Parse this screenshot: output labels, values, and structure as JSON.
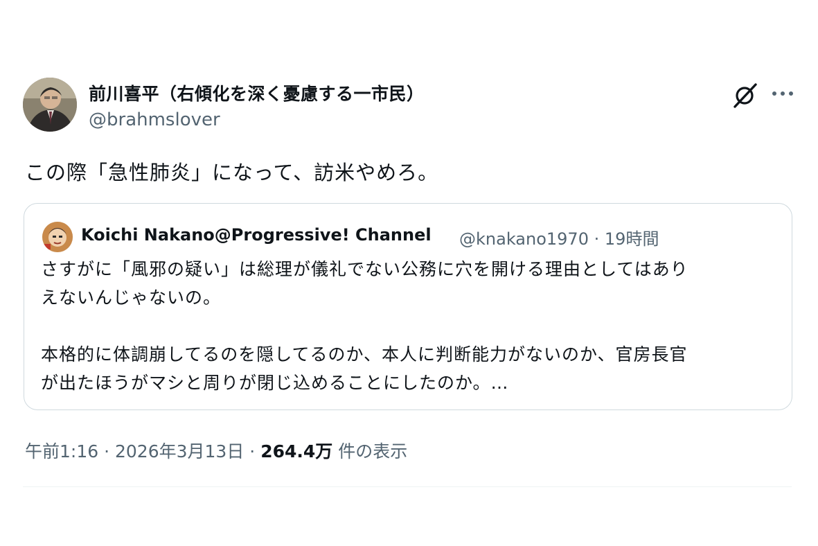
{
  "tweet": {
    "author_name": "前川喜平（右傾化を深く憂慮する一市民）",
    "author_handle": "@brahmslover",
    "text": "この際「急性肺炎」になって、訪米やめろ。",
    "timestamp": "午前1:16",
    "date": "2026年3月13日",
    "views_count": "264.4万",
    "views_label": "件の表示",
    "separator": "·"
  },
  "quoted": {
    "author_name": "Koichi Nakano@Progressive! Channel",
    "author_handle": "@knakano1970",
    "separator": "·",
    "time_ago": "19時間",
    "lines": [
      "さすがに「風邪の疑い」は総理が儀礼でない公務に穴を開ける理由としてはあり",
      "えないんじゃないの。",
      "",
      "本格的に体調崩してるのを隠してるのか、本人に判断能力がないのか、官房長官",
      "が出たほうがマシと周りが閉じ込めることにしたのか。…"
    ]
  },
  "icons": {
    "grok": "grok-icon",
    "more": "more-icon",
    "avatar": "avatar",
    "quoted_avatar": "avatar"
  },
  "colors": {
    "text": "#0f1419",
    "secondary": "#536471",
    "border": "#cfd9de"
  }
}
